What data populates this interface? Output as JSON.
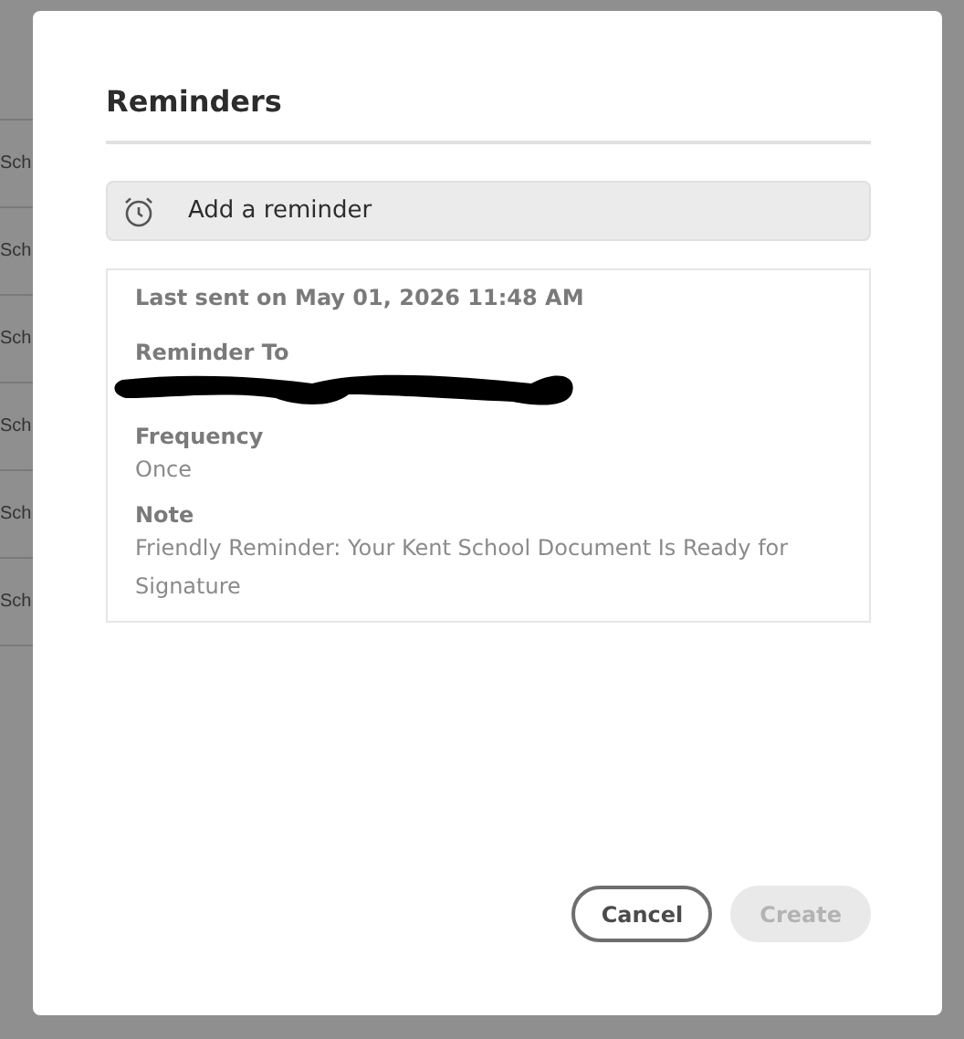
{
  "background_table": {
    "rows": [
      {
        "cell": "Sch"
      },
      {
        "cell": "Sch"
      },
      {
        "cell": "Sch"
      },
      {
        "cell": "Sch"
      },
      {
        "cell": "Sch"
      },
      {
        "cell": "Sch"
      }
    ]
  },
  "dialog": {
    "title": "Reminders",
    "add_button": {
      "label": "Add a reminder"
    },
    "reminder": {
      "last_sent": "Last sent on May 01, 2026 11:48 AM",
      "fields": [
        {
          "label": "Reminder To",
          "kind": "redacted"
        },
        {
          "label": "Frequency",
          "kind": "text",
          "value": "Once"
        },
        {
          "label": "Note",
          "kind": "text",
          "value": "Friendly Reminder: Your Kent School Document Is Ready for Signature"
        }
      ]
    },
    "buttons": [
      {
        "label": "Cancel",
        "kind": "secondary",
        "disabled": false
      },
      {
        "label": "Create",
        "kind": "primary",
        "disabled": true
      }
    ]
  }
}
